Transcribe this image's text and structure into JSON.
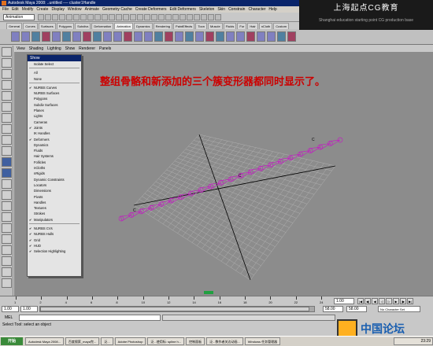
{
  "title_bar": {
    "text": "Autodesk Maya 2008: ..untitled  ----  cluster1Handle",
    "buttons": [
      "_",
      "□",
      "×"
    ]
  },
  "menu_bar": {
    "items": [
      "File",
      "Edit",
      "Modify",
      "Create",
      "Display",
      "Window",
      "Animate",
      "Geometry Cache",
      "Create Deformers",
      "Edit Deformers",
      "Skeleton",
      "Skin",
      "Constrain",
      "Character",
      "Help"
    ]
  },
  "status_line": {
    "mode": "Animation"
  },
  "watermark": {
    "main": "上海起点CG教育",
    "sub": "Shanghai education starting point CG production base"
  },
  "shelf_tabs": {
    "tabs": [
      "General",
      "Curves",
      "Surfaces",
      "Polygons",
      "Subdivs",
      "Deformation",
      "Animation",
      "Dynamics",
      "Rendering",
      "PaintEffects",
      "Toon",
      "Muscle",
      "Fluids",
      "Fur",
      "Hair",
      "nCloth",
      "Custom"
    ],
    "active_index": 6
  },
  "panel_menu": {
    "items": [
      "View",
      "Shading",
      "Lighting",
      "Show",
      "Renderer",
      "Panels"
    ]
  },
  "show_menu": {
    "header": "Show",
    "items": [
      {
        "label": "Isolate Select",
        "checked": false
      },
      {
        "sep": true
      },
      {
        "label": "All",
        "checked": false
      },
      {
        "label": "None",
        "checked": false
      },
      {
        "sep": true
      },
      {
        "label": "NURBS Curves",
        "checked": true
      },
      {
        "label": "NURBS Surfaces",
        "checked": false
      },
      {
        "label": "Polygons",
        "checked": false
      },
      {
        "label": "Subdiv Surfaces",
        "checked": false
      },
      {
        "label": "Planes",
        "checked": false
      },
      {
        "label": "Lights",
        "checked": false
      },
      {
        "label": "Cameras",
        "checked": false
      },
      {
        "label": "Joints",
        "checked": true
      },
      {
        "label": "IK Handles",
        "checked": false
      },
      {
        "label": "Deformers",
        "checked": true
      },
      {
        "label": "Dynamics",
        "checked": false
      },
      {
        "label": "Fluids",
        "checked": false
      },
      {
        "label": "Hair Systems",
        "checked": false
      },
      {
        "label": "Follicles",
        "checked": false
      },
      {
        "label": "nCloths",
        "checked": false
      },
      {
        "label": "nRigids",
        "checked": false
      },
      {
        "label": "Dynamic Constraints",
        "checked": false
      },
      {
        "label": "Locators",
        "checked": false
      },
      {
        "label": "Dimensions",
        "checked": false
      },
      {
        "label": "Pivots",
        "checked": false
      },
      {
        "label": "Handles",
        "checked": false
      },
      {
        "label": "Textures",
        "checked": false
      },
      {
        "label": "Strokes",
        "checked": false
      },
      {
        "label": "Manipulators",
        "checked": true
      },
      {
        "sep": true
      },
      {
        "label": "NURBS CVs",
        "checked": true
      },
      {
        "label": "NURBS Hulls",
        "checked": true
      },
      {
        "label": "Grid",
        "checked": true
      },
      {
        "label": "HUD",
        "checked": true
      },
      {
        "label": "Selection Highlighting",
        "checked": true
      }
    ]
  },
  "caption": "整组骨骼和新添加的三个簇变形器都同时显示了。",
  "time_slider": {
    "ticks": [
      "1",
      "2",
      "4",
      "6",
      "8",
      "10",
      "12",
      "14",
      "16",
      "18",
      "20",
      "22",
      "24"
    ],
    "current": "1.00"
  },
  "range_slider": {
    "start": "1.00",
    "inner_start": "1.00",
    "end": "58.00",
    "outer_end": "58.00",
    "character_set": "No Character Set"
  },
  "command_line": {
    "label": "MEL"
  },
  "help_line": "Select Tool: select an object",
  "taskbar": {
    "start": "开始",
    "tasks": [
      "Autodesk Maya 2008...",
      "百度搜索_maya完...",
      "泛...",
      "Adobe Photoshop",
      "泛...使用标: spline h...",
      "控制面板",
      "泛...数作者关边动画...",
      "Windows 任务管理器"
    ],
    "clock": "23:29"
  },
  "forum_logo": {
    "text": "中国论坛"
  },
  "colors": {
    "viewport_bg": "#8c8c8c",
    "joint_color": "#c020c0",
    "caption_color": "#cc0000"
  }
}
